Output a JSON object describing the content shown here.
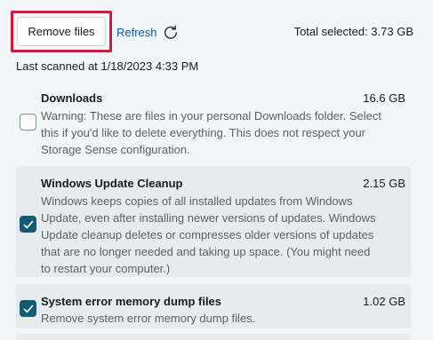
{
  "toolbar": {
    "remove_label": "Remove files",
    "refresh_label": "Refresh",
    "total_selected": "Total selected: 3.73 GB"
  },
  "last_scanned": "Last scanned at 1/18/2023 4:33 PM",
  "items": [
    {
      "title": "Downloads",
      "size": "16.6 GB",
      "checked": false,
      "desc_lines": [
        "Warning: These are files in your personal Downloads folder. Select",
        "this if you'd like to delete everything. This does not respect your",
        "Storage Sense configuration."
      ]
    },
    {
      "title": "Windows Update Cleanup",
      "size": "2.15 GB",
      "checked": true,
      "desc_lines": [
        "Windows keeps copies of all installed updates from Windows",
        "Update, even after installing newer versions of updates. Windows",
        "Update cleanup deletes or compresses older versions of updates",
        "that are no longer needed and taking up space. (You might need",
        "to restart your computer.)"
      ]
    },
    {
      "title": "System error memory dump files",
      "size": "1.02 GB",
      "checked": true,
      "desc_lines": [
        "Remove system error memory dump files."
      ]
    }
  ],
  "colors": {
    "highlight": "#e0143c",
    "accent": "#155a6e",
    "link": "#0a5ea8"
  }
}
